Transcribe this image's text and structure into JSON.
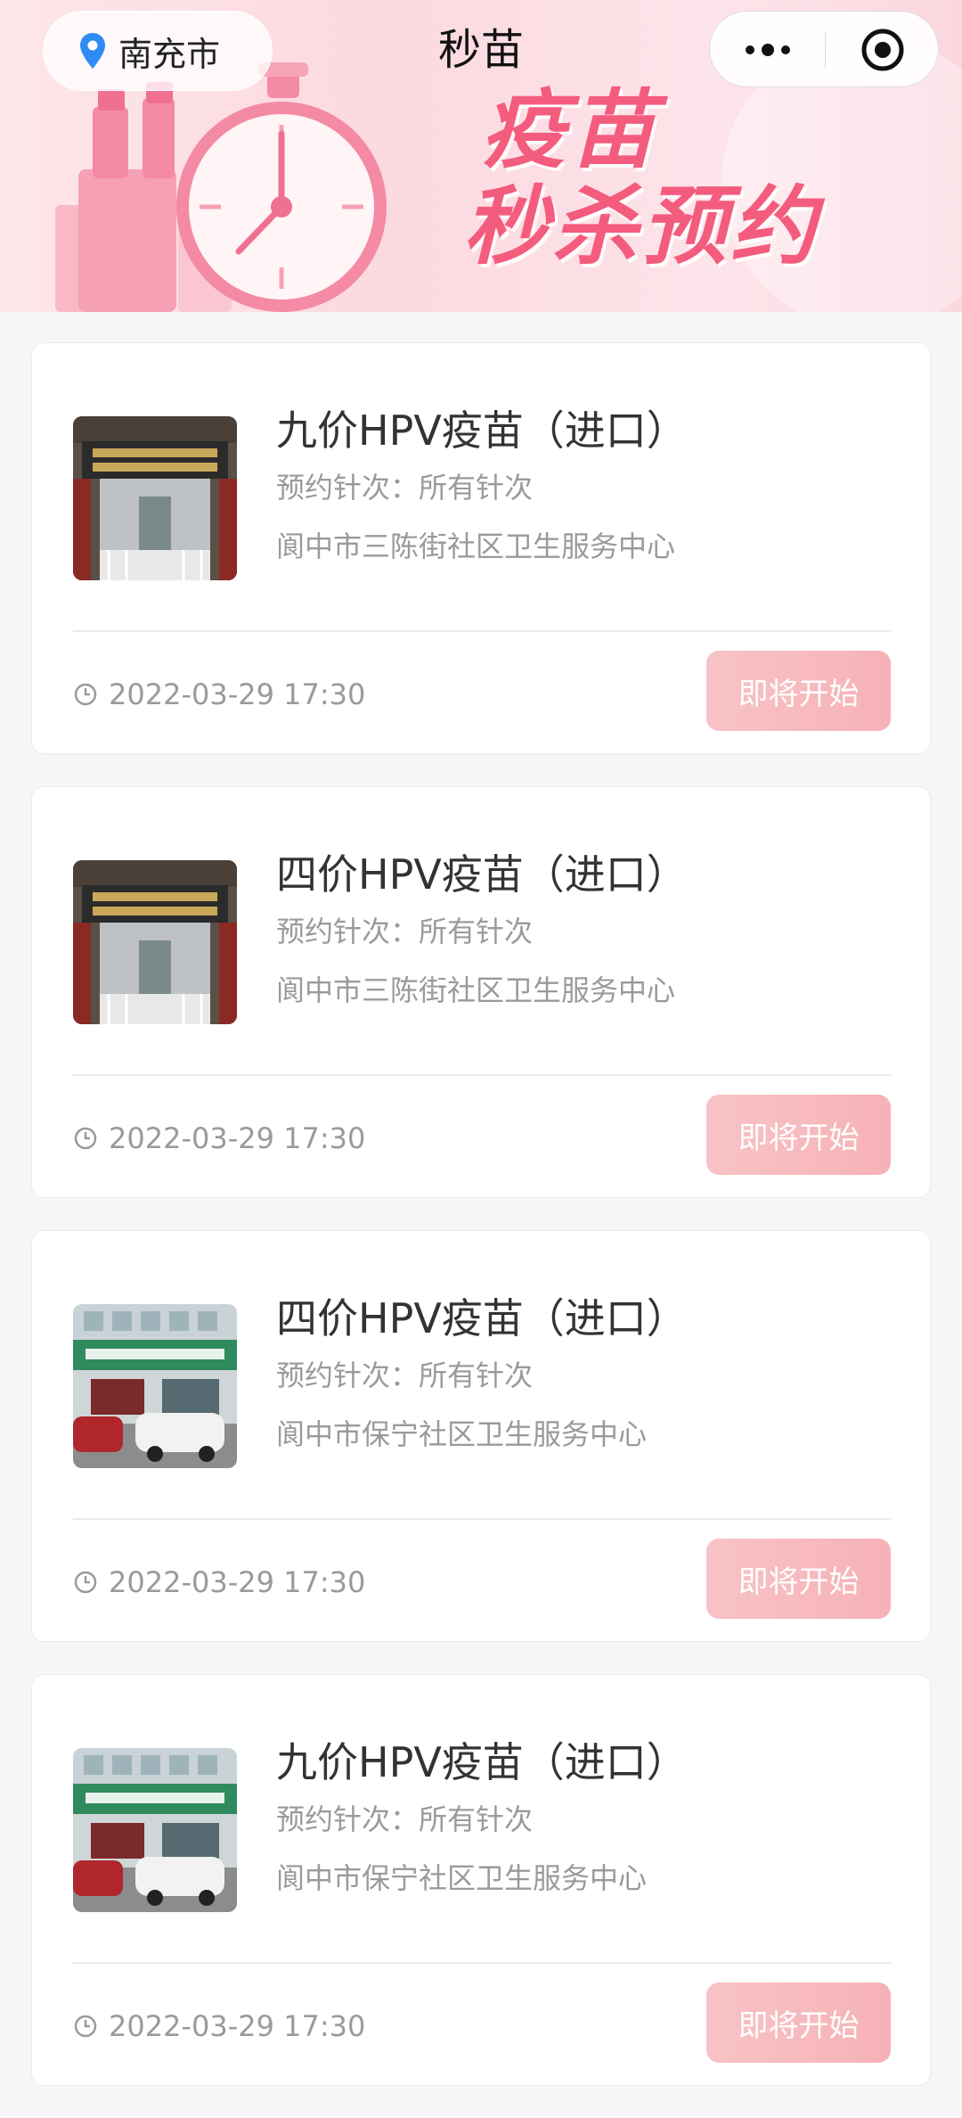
{
  "nav": {
    "location": "南充市",
    "title": "秒苗",
    "icons": {
      "location": "location-pin-icon",
      "more": "more-dots-icon",
      "close": "target-circle-icon"
    }
  },
  "banner": {
    "line1": "疫苗",
    "line2": "秒杀预约"
  },
  "theme": {
    "accent": "#f45c7e",
    "button": "#f7bcc0",
    "pin": "#2f8cf4"
  },
  "cards": [
    {
      "name": "九价HPV疫苗（进口）",
      "dose": "预约针次：所有针次",
      "site": "阆中市三陈街社区卫生服务中心",
      "time": "2022-03-29 17:30",
      "button": "即将开始",
      "thumb": "gate"
    },
    {
      "name": "四价HPV疫苗（进口）",
      "dose": "预约针次：所有针次",
      "site": "阆中市三陈街社区卫生服务中心",
      "time": "2022-03-29 17:30",
      "button": "即将开始",
      "thumb": "gate"
    },
    {
      "name": "四价HPV疫苗（进口）",
      "dose": "预约针次：所有针次",
      "site": "阆中市保宁社区卫生服务中心",
      "time": "2022-03-29 17:30",
      "button": "即将开始",
      "thumb": "building"
    },
    {
      "name": "九价HPV疫苗（进口）",
      "dose": "预约针次：所有针次",
      "site": "阆中市保宁社区卫生服务中心",
      "time": "2022-03-29 17:30",
      "button": "即将开始",
      "thumb": "building"
    }
  ]
}
